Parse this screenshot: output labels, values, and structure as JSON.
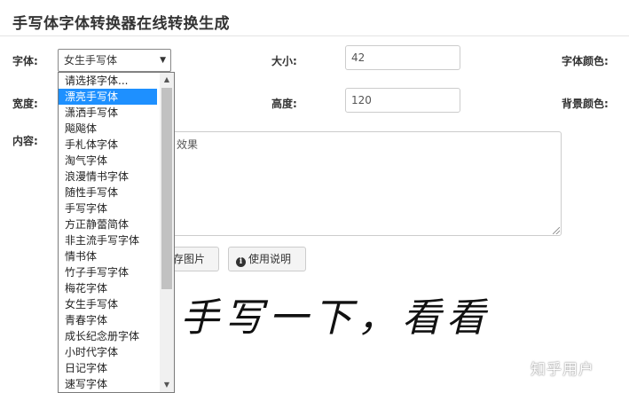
{
  "header": {
    "title": "手写体字体转换器在线转换生成"
  },
  "form": {
    "font_label": "字体:",
    "font_selected": "女生手写体",
    "size_label": "大小:",
    "size_value": "42",
    "font_color_label": "字体颜色:",
    "width_label": "宽度:",
    "height_label": "高度:",
    "height_value": "120",
    "bg_color_label": "背景颜色:",
    "content_label": "内容:",
    "content_value": "手写一下，看看效果",
    "content_visible": "效果"
  },
  "buttons": {
    "save_image": "保存图片",
    "save_image_visible": "存图片",
    "instructions": "使用说明"
  },
  "preview": {
    "text": "手写一下，看看"
  },
  "font_dropdown": {
    "options": [
      "请选择字体...",
      "漂亮手写体",
      "潇洒手写体",
      "飚飚体",
      "手札体字体",
      "淘气字体",
      "浪漫情书字体",
      "随性手写体",
      "手写字体",
      "方正静蕾简体",
      "非主流手写字体",
      "情书体",
      "竹子手写字体",
      "梅花字体",
      "女生手写体",
      "青春字体",
      "成长纪念册字体",
      "小时代字体",
      "日记字体",
      "速写字体"
    ],
    "highlighted": "漂亮手写体"
  },
  "watermark": "知乎用户",
  "colors": {
    "highlight": "#1e90ff",
    "border": "#cccccc"
  }
}
